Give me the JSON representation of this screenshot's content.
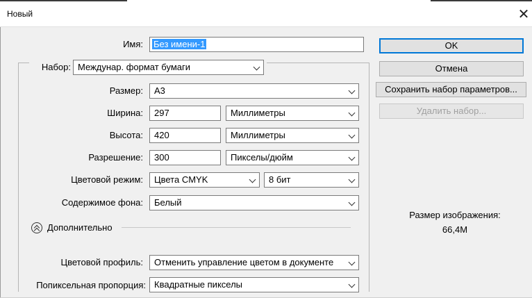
{
  "window": {
    "title": "Новый",
    "close_glyph": "✕"
  },
  "form": {
    "name_label": "Имя:",
    "name_value": "Без имени-1",
    "preset_label": "Набор:",
    "preset_value": "Междунар. формат бумаги",
    "size_label": "Размер:",
    "size_value": "A3",
    "width_label": "Ширина:",
    "width_value": "297",
    "width_unit": "Миллиметры",
    "height_label": "Высота:",
    "height_value": "420",
    "height_unit": "Миллиметры",
    "resolution_label": "Разрешение:",
    "resolution_value": "300",
    "resolution_unit": "Пикселы/дюйм",
    "color_mode_label": "Цветовой режим:",
    "color_mode_value": "Цвета CMYK",
    "bit_depth_value": "8 бит",
    "background_label": "Содержимое фона:",
    "background_value": "Белый",
    "advanced_label": "Дополнительно",
    "color_profile_label": "Цветовой профиль:",
    "color_profile_value": "Отменить управление цветом в документе",
    "pixel_aspect_label": "Попиксельная пропорция:",
    "pixel_aspect_value": "Квадратные пикселы"
  },
  "buttons": {
    "ok": "OK",
    "cancel": "Отмена",
    "save_preset": "Сохранить набор параметров...",
    "delete_preset": "Удалить набор..."
  },
  "info": {
    "image_size_label": "Размер изображения:",
    "image_size_value": "66,4M"
  },
  "colors": {
    "selection": "#3399ff",
    "default_button_border": "#0078d7"
  }
}
